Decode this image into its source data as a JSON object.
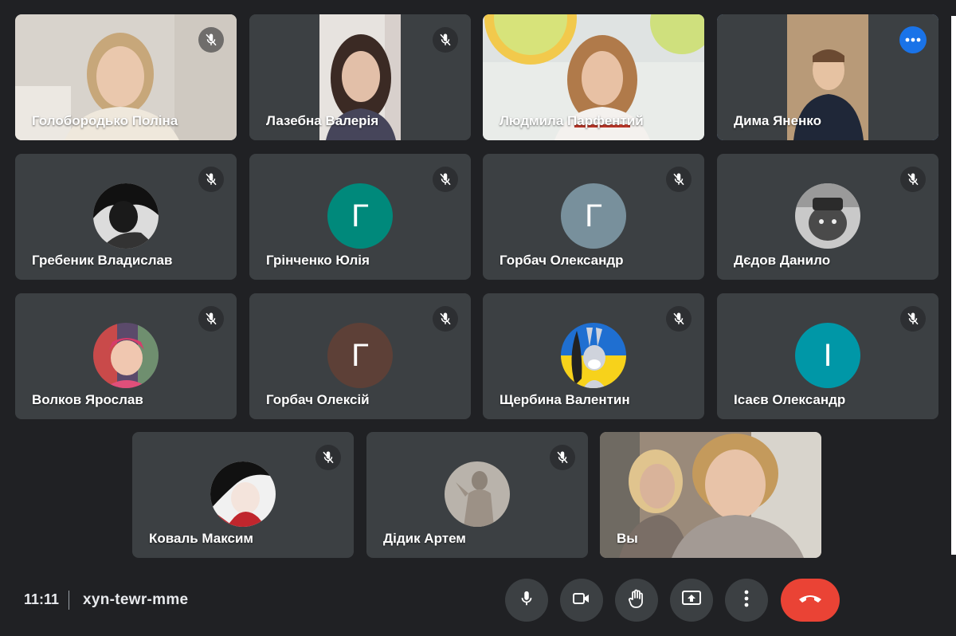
{
  "participants": [
    {
      "name": "Голобородько Поліна"
    },
    {
      "name": "Лазебна Валерія"
    },
    {
      "name": "Людмила Парфентий"
    },
    {
      "name": "Дима Яненко"
    },
    {
      "name": "Гребеник Владислав"
    },
    {
      "name": "Грінченко Юлія",
      "initial": "Г",
      "color": "#00897b"
    },
    {
      "name": "Горбач Олександр",
      "initial": "Г",
      "color": "#78909c"
    },
    {
      "name": "Дєдов Данило"
    },
    {
      "name": "Волков Ярослав"
    },
    {
      "name": "Горбач Олексій",
      "initial": "Г",
      "color": "#5d4037"
    },
    {
      "name": "Щербина Валентин"
    },
    {
      "name": "Ісаєв Олександр",
      "initial": "І",
      "color": "#0097a7"
    },
    {
      "name": "Коваль Максим"
    },
    {
      "name": "Дідик Артем"
    },
    {
      "name": "Вы"
    }
  ],
  "bottombar": {
    "time": "11:11",
    "meeting_code": "xyn-tewr-mme",
    "buttons": [
      "microphone-icon",
      "camera-icon",
      "raise-hand-icon",
      "present-screen-icon",
      "more-options-icon",
      "end-call-icon"
    ]
  },
  "colors": {
    "background": "#202124",
    "tile": "#3c4043",
    "active_outline": "#8ab4f8",
    "more_button": "#1a73e8",
    "hangup": "#ea4335"
  }
}
